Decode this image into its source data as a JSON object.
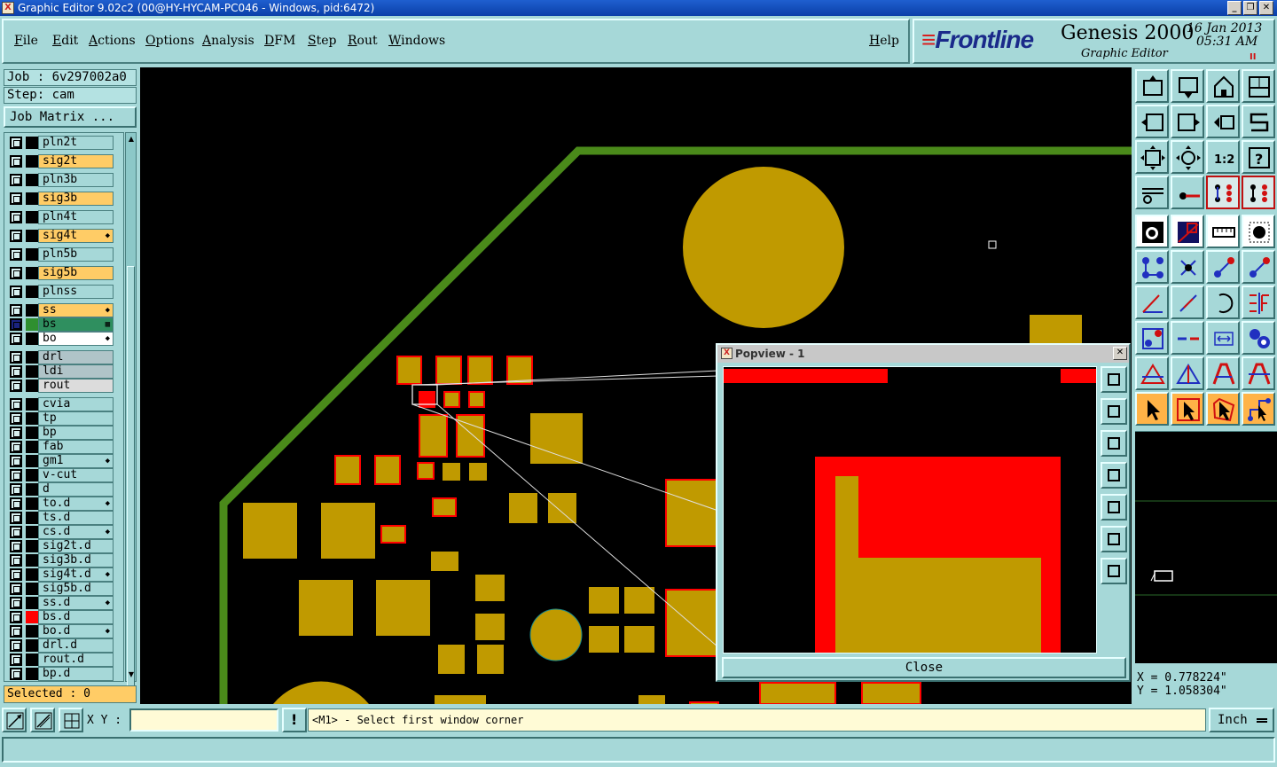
{
  "window": {
    "title": "Graphic Editor 9.02c2 (00@HY-HYCAM-PC046 - Windows, pid:6472)",
    "icon_label": "X",
    "controls": [
      "_",
      "❐",
      "✕"
    ]
  },
  "menu": [
    {
      "label": "File",
      "ul": "F",
      "rest": "ile"
    },
    {
      "label": "Edit",
      "ul": "E",
      "rest": "dit"
    },
    {
      "label": "Actions",
      "ul": "A",
      "rest": "ctions"
    },
    {
      "label": "Options",
      "ul": "O",
      "rest": "ptions"
    },
    {
      "label": "Analysis",
      "ul": "A",
      "rest": "nalysis"
    },
    {
      "label": "DFM",
      "ul": "D",
      "rest": "FM"
    },
    {
      "label": "Step",
      "ul": "S",
      "rest": "tep"
    },
    {
      "label": "Rout",
      "ul": "R",
      "rest": "out"
    },
    {
      "label": "Windows",
      "ul": "W",
      "rest": "indows"
    },
    {
      "label": "Help",
      "ul": "H",
      "rest": "elp"
    }
  ],
  "brand": {
    "logo": "Frontline",
    "product": "Genesis 2000",
    "subtitle": "Graphic Editor",
    "date": "16 Jan 2013",
    "time": "05:31  AM",
    "pause": "II"
  },
  "job": {
    "job_line": "Job : 6v297002a0",
    "step_line": "Step: cam",
    "matrix_button": "Job Matrix ..."
  },
  "layers": [
    {
      "name": "pln2t",
      "bg": "#a6d8d8",
      "swatch": "#000000",
      "mark": ""
    },
    {
      "name": "sig2t",
      "bg": "#ffcc66",
      "swatch": "#000000",
      "mark": ""
    },
    {
      "name": "pln3b",
      "bg": "#a6d8d8",
      "swatch": "#000000",
      "mark": ""
    },
    {
      "name": "sig3b",
      "bg": "#ffcc66",
      "swatch": "#000000",
      "mark": ""
    },
    {
      "name": "pln4t",
      "bg": "#a6d8d8",
      "swatch": "#000000",
      "mark": ""
    },
    {
      "name": "sig4t",
      "bg": "#ffcc66",
      "swatch": "#000000",
      "mark": "◆"
    },
    {
      "name": "pln5b",
      "bg": "#a6d8d8",
      "swatch": "#000000",
      "mark": ""
    },
    {
      "name": "sig5b",
      "bg": "#ffcc66",
      "swatch": "#000000",
      "mark": ""
    },
    {
      "name": "plnss",
      "bg": "#a6d8d8",
      "swatch": "#000000",
      "mark": ""
    },
    {
      "name": "ss",
      "bg": "#ffcc66",
      "swatch": "#000000",
      "mark": "◆"
    },
    {
      "name": "bs",
      "bg": "#2f8f5f",
      "swatch": "#2f8f2f",
      "mark": "▦",
      "active": true
    },
    {
      "name": "bo",
      "bg": "#ffffff",
      "swatch": "#000000",
      "mark": "◆"
    },
    {
      "name": "drl",
      "bg": "#b0c4c8",
      "swatch": "#000000",
      "mark": ""
    },
    {
      "name": "ldi",
      "bg": "#b0c4c8",
      "swatch": "#000000",
      "mark": ""
    },
    {
      "name": "rout",
      "bg": "#dcdcdc",
      "swatch": "#000000",
      "mark": ""
    },
    {
      "name": "cvia",
      "bg": "#a6d8d8",
      "swatch": "#000000",
      "mark": ""
    },
    {
      "name": "tp",
      "bg": "#a6d8d8",
      "swatch": "#000000",
      "mark": ""
    },
    {
      "name": "bp",
      "bg": "#a6d8d8",
      "swatch": "#000000",
      "mark": ""
    },
    {
      "name": "fab",
      "bg": "#a6d8d8",
      "swatch": "#000000",
      "mark": ""
    },
    {
      "name": "gm1",
      "bg": "#a6d8d8",
      "swatch": "#000000",
      "mark": "◆"
    },
    {
      "name": "v-cut",
      "bg": "#a6d8d8",
      "swatch": "#000000",
      "mark": ""
    },
    {
      "name": "d",
      "bg": "#a6d8d8",
      "swatch": "#000000",
      "mark": ""
    },
    {
      "name": "to.d",
      "bg": "#a6d8d8",
      "swatch": "#000000",
      "mark": "◆"
    },
    {
      "name": "ts.d",
      "bg": "#a6d8d8",
      "swatch": "#000000",
      "mark": ""
    },
    {
      "name": "cs.d",
      "bg": "#a6d8d8",
      "swatch": "#000000",
      "mark": "◆"
    },
    {
      "name": "sig2t.d",
      "bg": "#a6d8d8",
      "swatch": "#000000",
      "mark": ""
    },
    {
      "name": "sig3b.d",
      "bg": "#a6d8d8",
      "swatch": "#000000",
      "mark": ""
    },
    {
      "name": "sig4t.d",
      "bg": "#a6d8d8",
      "swatch": "#000000",
      "mark": "◆"
    },
    {
      "name": "sig5b.d",
      "bg": "#a6d8d8",
      "swatch": "#000000",
      "mark": ""
    },
    {
      "name": "ss.d",
      "bg": "#a6d8d8",
      "swatch": "#000000",
      "mark": "◆"
    },
    {
      "name": "bs.d",
      "bg": "#a6d8d8",
      "swatch": "#ff0000",
      "mark": ""
    },
    {
      "name": "bo.d",
      "bg": "#a6d8d8",
      "swatch": "#000000",
      "mark": "◆"
    },
    {
      "name": "drl.d",
      "bg": "#a6d8d8",
      "swatch": "#000000",
      "mark": ""
    },
    {
      "name": "rout.d",
      "bg": "#a6d8d8",
      "swatch": "#000000",
      "mark": ""
    },
    {
      "name": "bp.d",
      "bg": "#a6d8d8",
      "swatch": "#000000",
      "mark": ""
    }
  ],
  "selected": "Selected : 0",
  "popview": {
    "title": "Popview - 1",
    "close_button": "Close"
  },
  "coords": {
    "x_line": "X = 0.778224\"",
    "y_line": "Y = 1.058304\""
  },
  "bottom": {
    "xy_label": "X Y :",
    "xy_value": "",
    "warn_icon": "!",
    "prompt": "<M1> - Select first window corner",
    "unit": "Inch"
  },
  "colors": {
    "copper": "#c09a00",
    "red_soldermask": "#ff0000",
    "outline_green": "#4a8a1a",
    "panel": "#a6d8d8",
    "highlight_orange": "#ffcc66"
  }
}
